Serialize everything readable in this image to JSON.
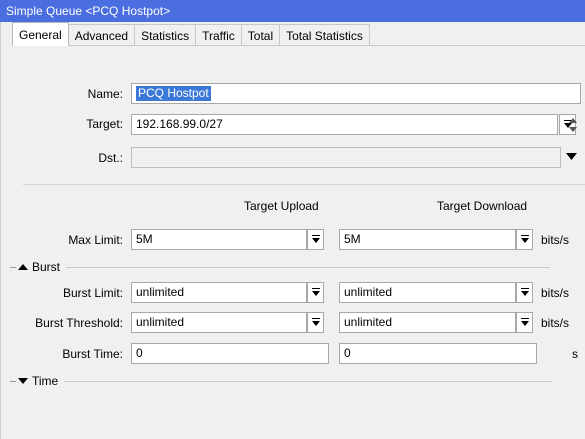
{
  "window": {
    "title": "Simple Queue <PCQ Hostpot>"
  },
  "tabs": [
    "General",
    "Advanced",
    "Statistics",
    "Traffic",
    "Total",
    "Total Statistics"
  ],
  "general": {
    "name_label": "Name:",
    "name_value": "PCQ Hostpot",
    "target_label": "Target:",
    "target_value": "192.168.99.0/27",
    "dst_label": "Dst.:",
    "dst_value": ""
  },
  "columns": {
    "upload": "Target Upload",
    "download": "Target Download"
  },
  "max_limit": {
    "label": "Max Limit:",
    "upload": "5M",
    "download": "5M",
    "unit": "bits/s"
  },
  "burst_section": {
    "label": "Burst",
    "expanded": true
  },
  "burst_limit": {
    "label": "Burst Limit:",
    "upload": "unlimited",
    "download": "unlimited",
    "unit": "bits/s"
  },
  "burst_threshold": {
    "label": "Burst Threshold:",
    "upload": "unlimited",
    "download": "unlimited",
    "unit": "bits/s"
  },
  "burst_time": {
    "label": "Burst Time:",
    "upload": "0",
    "download": "0",
    "unit": "s"
  },
  "time_section": {
    "label": "Time",
    "expanded": false
  },
  "colors": {
    "titlebar": "#4a6ee0",
    "selection": "#3b78d8",
    "background": "#f0f0f0"
  }
}
